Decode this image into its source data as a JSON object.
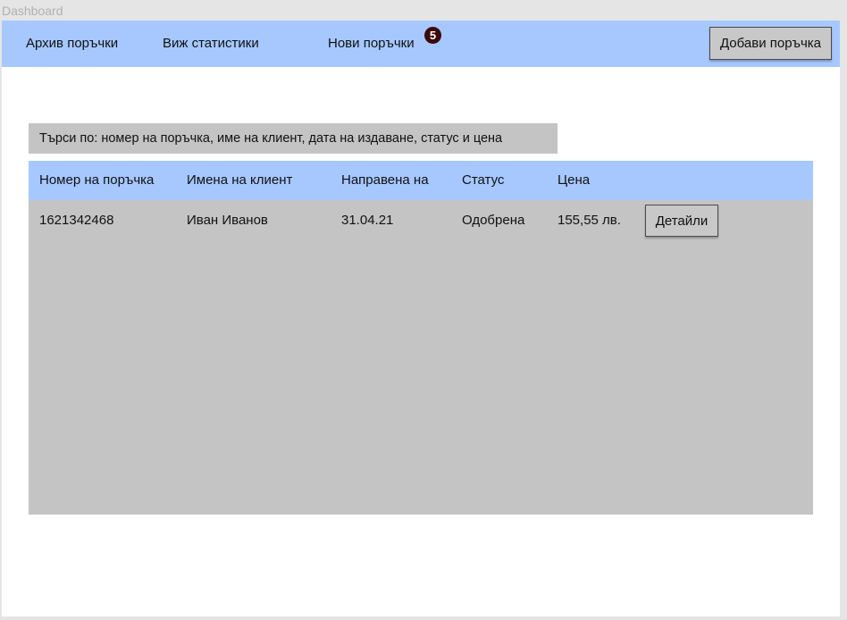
{
  "window": {
    "title": "Dashboard"
  },
  "navbar": {
    "links": [
      {
        "label": "Архив поръчки"
      },
      {
        "label": "Виж статистики"
      },
      {
        "label": "Нови поръчки"
      }
    ],
    "new_orders_badge": "5",
    "add_order_label": "Добави поръчка"
  },
  "search": {
    "placeholder": "Търси по: номер на поръчка, име на клиент, дата на издаване, статус и цена"
  },
  "table": {
    "columns": [
      "Номер на поръчка",
      "Имена на клиент",
      "Направена на",
      "Статус",
      "Цена"
    ],
    "rows": [
      {
        "order_number": "1621342468",
        "client_name": "Иван Иванов",
        "date": "31.04.21",
        "status": "Одобрена",
        "price": "155,55 лв.",
        "details_label": "Детайли"
      }
    ]
  },
  "colors": {
    "navbar_bg": "#a6c8ff",
    "table_bg": "#c4c4c4",
    "badge_bg": "#3b0a0a"
  }
}
